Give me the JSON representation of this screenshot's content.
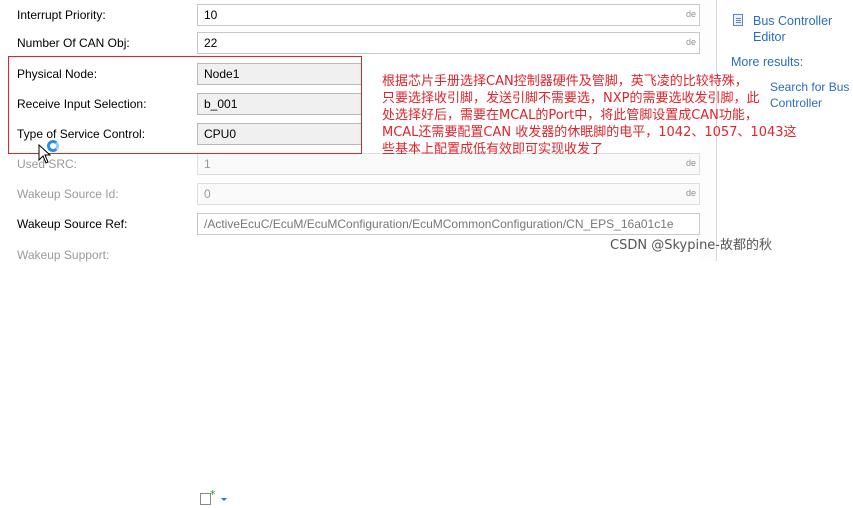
{
  "form": {
    "rows": [
      {
        "label": "Interrupt Priority:",
        "value": "10",
        "suffix": "de"
      },
      {
        "label": "Number Of CAN Obj:",
        "value": "22",
        "suffix": "de"
      },
      {
        "label": "Physical Node:",
        "value": "Node1",
        "suffix": ""
      },
      {
        "label": "Receive Input Selection:",
        "value": "b_001",
        "suffix": ""
      },
      {
        "label": "Type of Service Control:",
        "value": "CPU0",
        "suffix": ""
      },
      {
        "label": "Used SRC:",
        "value": "1",
        "suffix": "de"
      },
      {
        "label": "Wakeup Source Id:",
        "value": "0",
        "suffix": "de"
      },
      {
        "label": "Wakeup Source Ref:",
        "value": "/ActiveEcuC/EcuM/EcuMConfiguration/EcuMCommonConfiguration/CN_EPS_16a01c1e",
        "suffix": ""
      },
      {
        "label": "Wakeup Support:",
        "value": "",
        "suffix": ""
      }
    ]
  },
  "annotation": {
    "lines": [
      "根据芯片手册选择CAN控制器硬件及管脚，英飞凌的比较特殊，",
      "只要选择收引脚，发送引脚不需要选，NXP的需要选收发引脚，此",
      "处选择好后，需要在MCAL的Port中，将此管脚设置成CAN功能，",
      "MCAL还需要配置CAN 收发器的休眠脚的电平，1042、1057、1043这",
      "些基本上配置成低有效即可实现收发了"
    ]
  },
  "side_panel": {
    "help_link": "Bus Controller Editor",
    "more_results": "More results:",
    "result_partial_1": "Search for Bus",
    "result_partial_2": "Controller"
  },
  "watermark": "CSDN @Skypine-故都的秋",
  "colors": {
    "annotation_red": "#e0242b",
    "link_blue": "#2b6cc4"
  }
}
